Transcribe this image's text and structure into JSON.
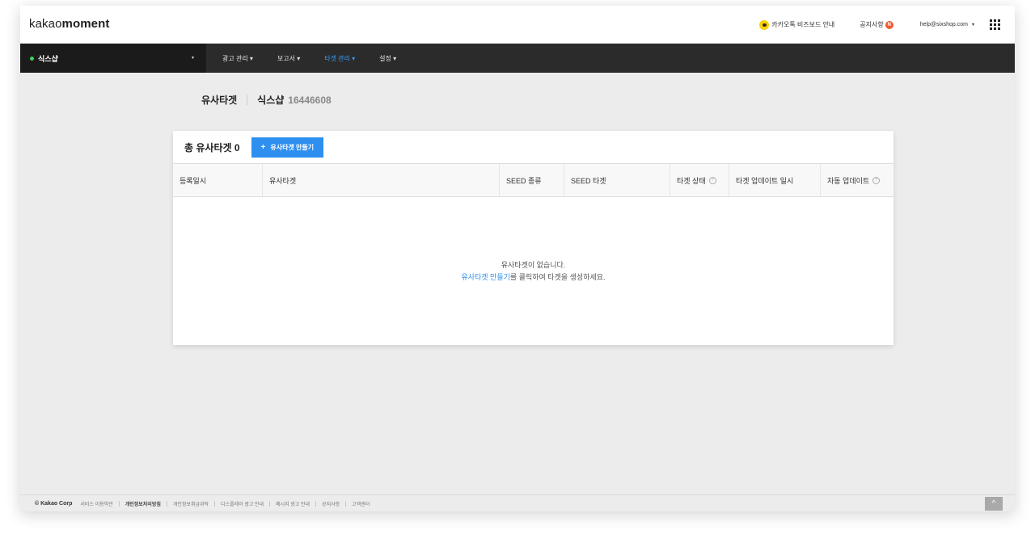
{
  "header": {
    "logo_plain": "kakao",
    "logo_bold": "moment",
    "bizboard": "카카오톡 비즈보드 안내",
    "notice": "공지사항",
    "notice_badge": "N",
    "account": "help@sixshop.com",
    "account_caret": "▾",
    "apps_icon": "grid-icon"
  },
  "nav": {
    "shop_name": "식스샵",
    "shop_caret": "▾",
    "items": [
      {
        "label": "광고 관리 ▾",
        "active": false
      },
      {
        "label": "보고서 ▾",
        "active": false
      },
      {
        "label": "타겟 관리 ▾",
        "active": true
      },
      {
        "label": "설정 ▾",
        "active": false
      }
    ],
    "accent_color": "#3a9bf0"
  },
  "page": {
    "title": "유사타겟",
    "shop": "식스샵",
    "shop_id": "16446608"
  },
  "card": {
    "total_label": "총 유사타겟 0",
    "create_plus": "+",
    "create_button": "유사타겟 만들기",
    "columns": [
      "등록일시",
      "유사타겟",
      "SEED 종류",
      "SEED 타겟",
      "타겟 상태",
      "타겟 업데이트 일시",
      "자동 업데이트"
    ],
    "help_mark": "?",
    "empty_line1": "유사타겟이 없습니다.",
    "empty_link": "유사타겟 만들기",
    "empty_line2_rest": "를 클릭하여 타겟을 생성하세요."
  },
  "footer": {
    "copyright": "© Kakao Corp",
    "links": [
      "서비스 이용약관",
      "개인정보처리방침",
      "개인정보취급위탁",
      "디스플레이 광고 안내",
      "메시지 광고 안내",
      "공지사항",
      "고객센터"
    ],
    "to_top": "^"
  }
}
